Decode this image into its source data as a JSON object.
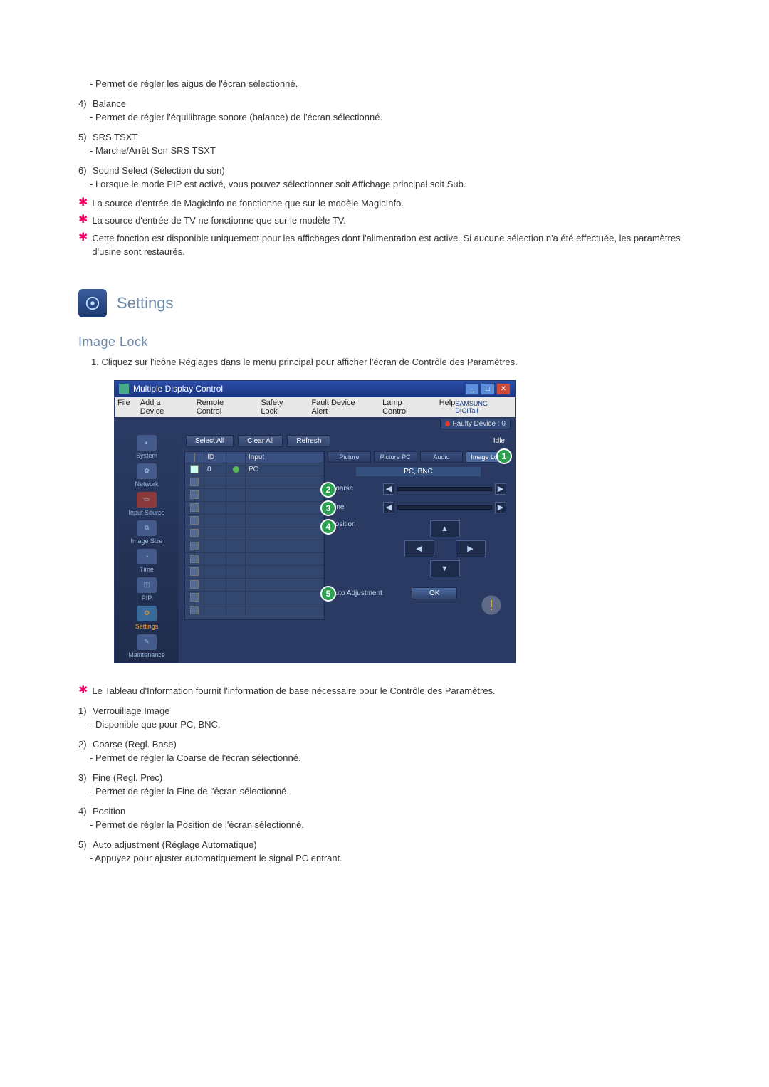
{
  "top_list": [
    {
      "sub": "Permet de régler les aigus de l'écran sélectionné."
    },
    {
      "num": "4)",
      "label": "Balance",
      "sub": "Permet de régler l'équilibrage sonore (balance) de l'écran sélectionné."
    },
    {
      "num": "5)",
      "label": "SRS TSXT",
      "sub": "Marche/Arrêt Son SRS TSXT"
    },
    {
      "num": "6)",
      "label": "Sound Select (Sélection du son)",
      "sub": "Lorsque le mode PIP est activé, vous pouvez sélectionner soit Affichage principal soit Sub."
    }
  ],
  "stars": [
    "La source d'entrée de MagicInfo ne fonctionne que sur le modèle MagicInfo.",
    "La source d'entrée de TV ne fonctionne que sur le modèle TV.",
    "Cette fonction est disponible uniquement pour les affichages dont l'alimentation est active. Si aucune sélection n'a été effectuée, les paramètres d'usine sont restaurés."
  ],
  "section_title": "Settings",
  "sub_heading": "Image Lock",
  "intro": "1.  Cliquez sur l'icône Réglages dans le menu principal pour afficher l'écran de Contrôle des Paramètres.",
  "app": {
    "title": "Multiple Display Control",
    "menus": [
      "File",
      "Add a Device",
      "Remote Control",
      "Safety Lock",
      "Fault Device Alert",
      "Lamp Control",
      "Help"
    ],
    "brand": "SAMSUNG DIGITall",
    "faulty": "Faulty Device : 0",
    "toolbar": {
      "select_all": "Select All",
      "clear_all": "Clear All",
      "refresh": "Refresh",
      "idle": "Idle"
    },
    "grid": {
      "headers": [
        "",
        "ID",
        "",
        "Input"
      ],
      "row0": {
        "id": "0",
        "input": "PC"
      }
    },
    "sidebar": [
      "System",
      "Network",
      "Input Source",
      "Image Size",
      "Time",
      "PIP",
      "Settings",
      "Maintenance"
    ],
    "tabs": [
      "Picture",
      "Picture PC",
      "Audio",
      "Image Lock"
    ],
    "pcbnc": "PC, BNC",
    "coarse": "Coarse",
    "fine": "Fine",
    "position": "Position",
    "auto": "Auto Adjustment",
    "ok": "OK"
  },
  "post_star": "Le Tableau d'Information fournit l'information de base nécessaire pour le Contrôle des Paramètres.",
  "bottom_list": [
    {
      "num": "1)",
      "label": "Verrouillage Image",
      "sub": "Disponible que pour PC, BNC."
    },
    {
      "num": "2)",
      "label": "Coarse (Regl. Base)",
      "sub": "Permet de régler la Coarse de l'écran sélectionné."
    },
    {
      "num": "3)",
      "label": "Fine (Regl. Prec)",
      "sub": "Permet de régler la Fine de l'écran sélectionné."
    },
    {
      "num": "4)",
      "label": "Position",
      "sub": "Permet de régler la Position de l'écran sélectionné."
    },
    {
      "num": "5)",
      "label": "Auto adjustment (Réglage Automatique)",
      "sub": "Appuyez pour ajuster automatiquement le signal PC entrant."
    }
  ]
}
